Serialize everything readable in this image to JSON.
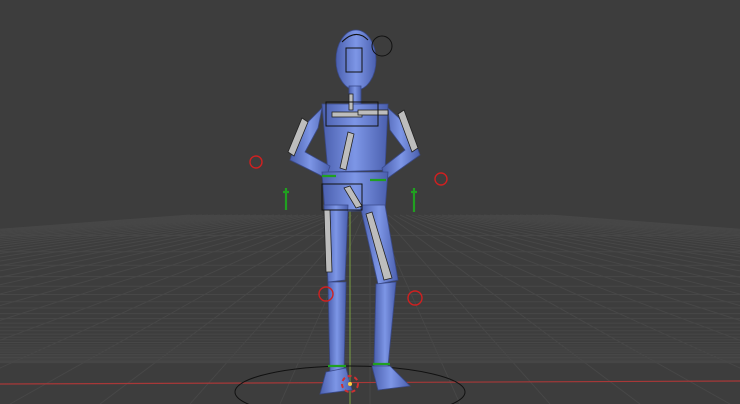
{
  "viewport": {
    "background": "#3d3d3d",
    "grid_color": "#4a4a4a",
    "x_axis_color": "#b03a3a",
    "y_axis_color": "#6a9a3a"
  },
  "character": {
    "mesh_color": "#6c86d8",
    "bone_color": "#b8b8b8",
    "ik_control_color": "#d02020",
    "pole_color": "#20a020"
  }
}
